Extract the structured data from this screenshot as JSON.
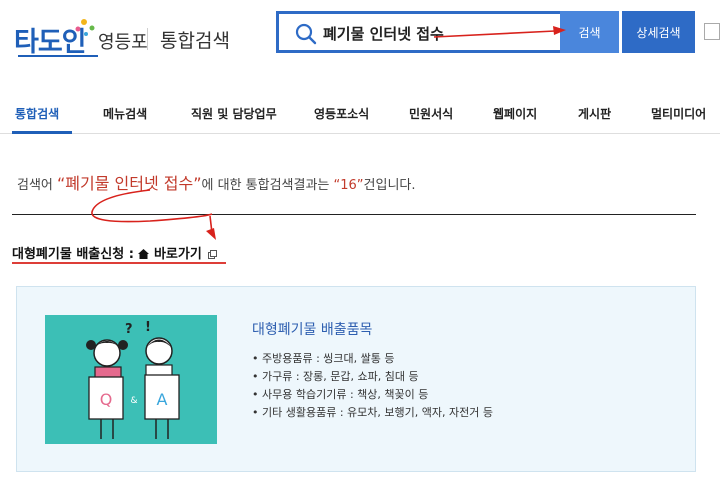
{
  "header": {
    "logo_text": "타도인",
    "logo_sub": "영등포",
    "title": "통합검색",
    "search_value": "폐기물 인터넷 접수",
    "search_button": "검색",
    "detail_button": "상세검색"
  },
  "nav": {
    "items": [
      {
        "label": "통합검색",
        "active": true
      },
      {
        "label": "메뉴검색"
      },
      {
        "label": "직원 및 담당업무"
      },
      {
        "label": "영등포소식"
      },
      {
        "label": "민원서식"
      },
      {
        "label": "웹페이지"
      },
      {
        "label": "게시판"
      },
      {
        "label": "멀티미디어"
      }
    ]
  },
  "summary": {
    "prefix": "검색어 ",
    "query": "“폐기물 인터넷 접수”",
    "middle": "에 대한 통합검색결과는 ",
    "count": "“16”",
    "suffix": "건입니다."
  },
  "section": {
    "title": "대형폐기물 배출신청 : ",
    "link_label": "바로가기"
  },
  "result": {
    "title": "대형폐기물 배출품목",
    "items": [
      "주방용품류 : 씽크대, 쌀통 등",
      "가구류 : 장롱, 문갑, 쇼파, 침대 등",
      "사무용 학습기기류 : 책상, 책꽂이 등",
      "기타 생활용품류 : 유모차, 보행기, 액자, 자전거 등"
    ],
    "thumb_labels": {
      "q": "Q",
      "and": "&",
      "a": "A",
      "qmark": "?",
      "excl": "!"
    }
  },
  "colors": {
    "brand_blue": "#1f5fb8",
    "search_border": "#2e6bc6",
    "annotation_red": "#d8221c",
    "card_bg": "#eef7fc",
    "thumb_teal": "#3cbfb6"
  }
}
